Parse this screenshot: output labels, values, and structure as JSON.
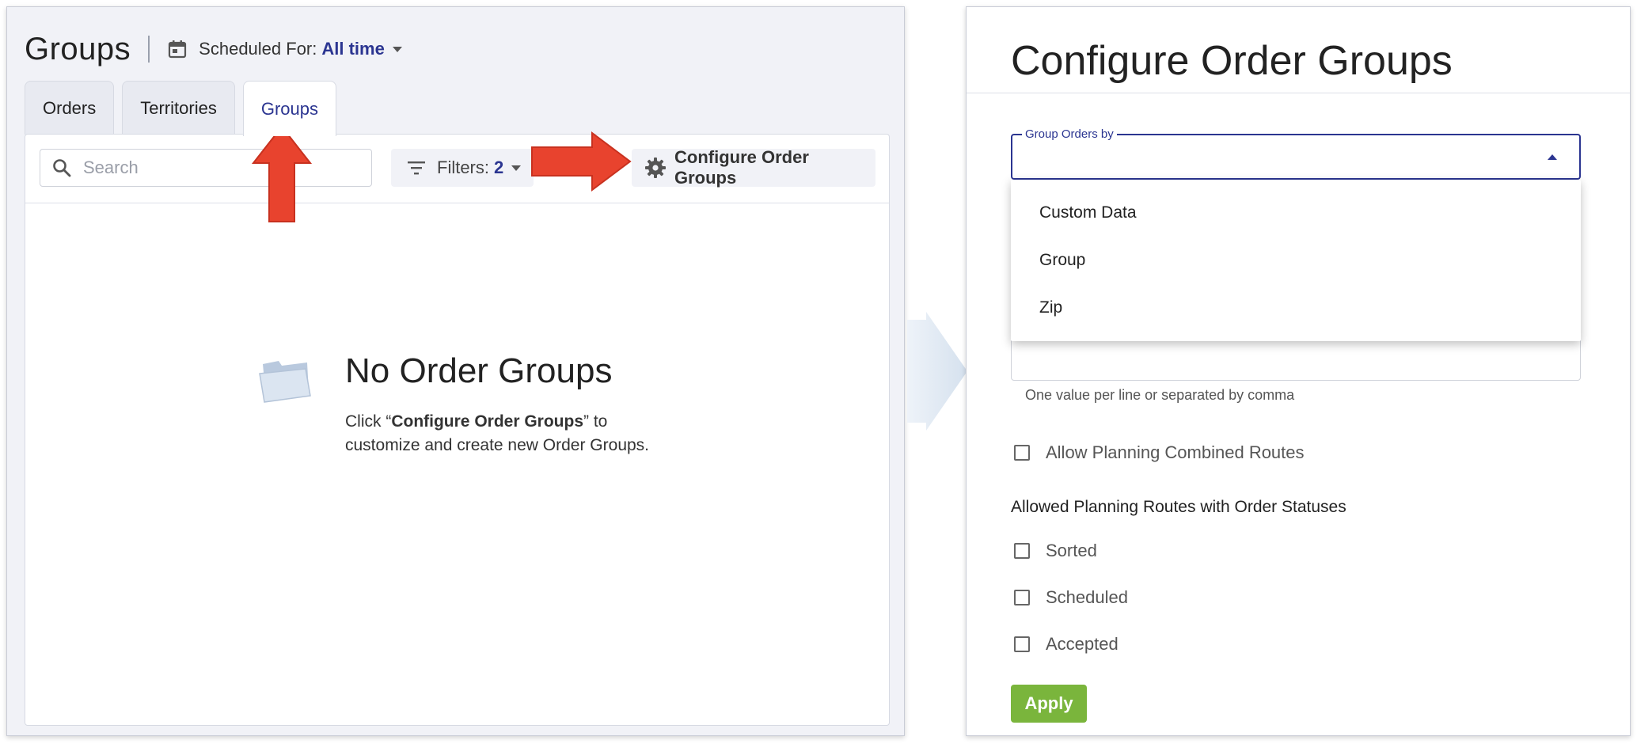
{
  "left": {
    "title": "Groups",
    "scheduled": {
      "label": "Scheduled For:",
      "value": "All time"
    },
    "tabs": [
      {
        "label": "Orders"
      },
      {
        "label": "Territories"
      },
      {
        "label": "Groups",
        "active": true
      }
    ],
    "search": {
      "placeholder": "Search",
      "value": ""
    },
    "filters": {
      "label": "Filters:",
      "count": "2"
    },
    "config_button": "Configure Order Groups",
    "empty": {
      "title": "No Order Groups",
      "desc_prefix": "Click “",
      "desc_bold": "Configure Order Groups",
      "desc_suffix": "” to customize and create new Order Groups."
    }
  },
  "right": {
    "title": "Configure Order Groups",
    "group_by": {
      "label": "Group Orders by",
      "value": ""
    },
    "dropdown_options": [
      "Custom Data",
      "Group",
      "Zip"
    ],
    "values_hint": "One value per line or separated by comma",
    "allow_combined": "Allow Planning Combined Routes",
    "statuses_label": "Allowed Planning Routes with Order Statuses",
    "statuses": [
      "Sorted",
      "Scheduled",
      "Accepted"
    ],
    "apply": "Apply"
  },
  "colors": {
    "accent": "#2b3591",
    "arrow": "#e8432e",
    "apply": "#7ab53c",
    "panel_bg": "#f1f2f7"
  }
}
